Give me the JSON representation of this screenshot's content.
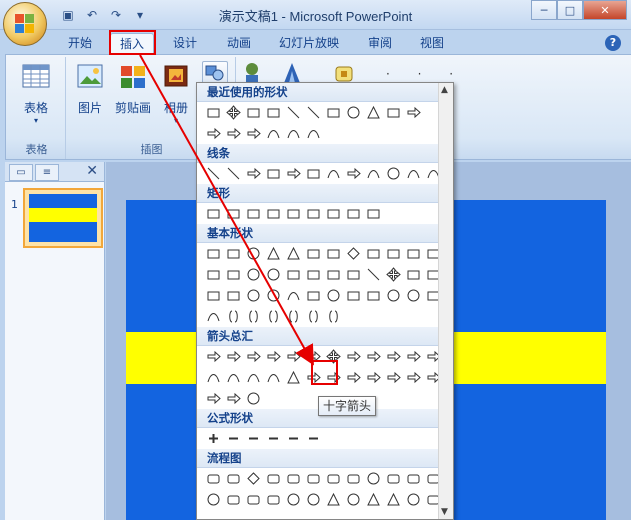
{
  "window": {
    "title": "演示文稿1 - Microsoft PowerPoint",
    "controls": {
      "minimize": "─",
      "maximize": "□",
      "close": "✕"
    }
  },
  "qat": [
    {
      "name": "save-icon",
      "glyph": "▣"
    },
    {
      "name": "undo-icon",
      "glyph": "↶"
    },
    {
      "name": "redo-icon",
      "glyph": "↷"
    },
    {
      "name": "customize-icon",
      "glyph": "▾"
    }
  ],
  "tabs": [
    "开始",
    "插入",
    "设计",
    "动画",
    "幻灯片放映",
    "审阅",
    "视图"
  ],
  "active_tab": "插入",
  "ribbon": {
    "groups": [
      {
        "label": "表格",
        "buttons": [
          "表格"
        ]
      },
      {
        "label": "插图",
        "buttons": [
          "图片",
          "剪贴画",
          "相册"
        ]
      }
    ]
  },
  "slide_pane": {
    "slide_number": "1"
  },
  "gallery": {
    "sections": [
      {
        "title": "最近使用的形状",
        "rows": [
          [
            "text-box",
            "cross",
            "textbox-v",
            "textbox-h",
            "line",
            "arrow-line",
            "rect",
            "oval",
            "triangle",
            "elbow",
            "elbow-arrow"
          ],
          [
            "arrow-right",
            "arrow-down",
            "rounded-callout",
            "curly",
            "arc",
            "wave"
          ]
        ]
      },
      {
        "title": "线条",
        "rows": [
          [
            "line",
            "arrow-line",
            "double-arrow",
            "elbow",
            "elbow-arrow",
            "elbow-double",
            "curve",
            "curve-arrow",
            "curve-double",
            "freeform",
            "scribble",
            "wave"
          ]
        ]
      },
      {
        "title": "矩形",
        "rows": [
          [
            "rect",
            "round-rect",
            "snip1",
            "snip2",
            "snip-round",
            "round1",
            "round2",
            "round-diag",
            "frame"
          ]
        ]
      },
      {
        "title": "基本形状",
        "rows": [
          [
            "textbox-h",
            "textbox-v",
            "oval",
            "triangle",
            "right-tri",
            "parallelogram",
            "trapezoid",
            "diamond",
            "pentagon",
            "hexagon",
            "heptagon",
            "octagon"
          ],
          [
            "decagon",
            "dodecagon",
            "pie",
            "chord",
            "teardrop",
            "frame",
            "half-frame",
            "l-shape",
            "diagonal",
            "cross",
            "plaque",
            "can"
          ],
          [
            "cube",
            "bevel",
            "donut",
            "no-symbol",
            "block-arc",
            "fold",
            "smiley",
            "heart",
            "lightning",
            "sun",
            "moon",
            "cloud"
          ],
          [
            "arc",
            "bracket-pair",
            "brace-pair",
            "left-bracket",
            "right-bracket",
            "left-brace",
            "right-brace"
          ]
        ]
      },
      {
        "title": "箭头总汇",
        "rows": [
          [
            "arrow-right",
            "arrow-left",
            "arrow-up",
            "arrow-down",
            "arrow-lr",
            "arrow-ud",
            "cross-arrow",
            "three-arrow",
            "bent-arrow",
            "u-turn",
            "left-up",
            "bent-up"
          ],
          [
            "curved-right",
            "curved-left",
            "curved-up",
            "curved-down",
            "striped",
            "notched",
            "pentagon-arrow",
            "chevron",
            "callout-right",
            "callout-left",
            "callout-up",
            "callout-down"
          ],
          [
            "callout-lr",
            "callout-quad",
            "circular"
          ]
        ]
      },
      {
        "title": "公式形状",
        "rows": [
          [
            "plus",
            "minus",
            "multiply",
            "divide",
            "equal",
            "not-equal"
          ]
        ]
      },
      {
        "title": "流程图",
        "rows": [
          [
            "process",
            "alt-process",
            "decision",
            "data",
            "predefined",
            "internal",
            "document",
            "multidoc",
            "terminator",
            "preparation",
            "manual-input",
            "manual-op"
          ],
          [
            "connector",
            "offpage",
            "card",
            "punched",
            "summing",
            "or",
            "collate",
            "sort",
            "extract",
            "merge",
            "stored",
            "delay"
          ]
        ]
      }
    ]
  },
  "tooltip": "十字箭头",
  "colors": {
    "slide_bg": "#1364E0",
    "slide_band": "#FFFF00",
    "annotation": "#E60000"
  }
}
